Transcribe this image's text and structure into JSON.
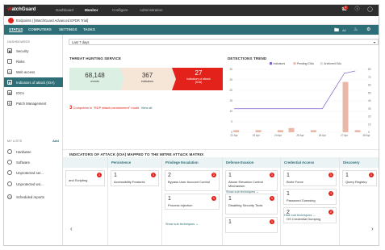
{
  "topbar": {
    "logo_a": "W",
    "logo_b": "atchGuard",
    "nav": [
      "Dashboard",
      "Monitor",
      "Configure",
      "Administration"
    ],
    "active": "Monitor",
    "badge": "4"
  },
  "breadcrumb": {
    "label": "Endpoints",
    "account": "[WatchGuard Advanced EPDR Trial]"
  },
  "subnav": {
    "items": [
      "STATUS",
      "COMPUTERS",
      "SETTINGS",
      "TASKS"
    ],
    "all_label": "All"
  },
  "sidebar": {
    "dashboards_heading": "DASHBOARDS",
    "dashboards": [
      "Security",
      "Risks",
      "Web access",
      "Indicators of attack (IOA)",
      "IOCs",
      "Patch Management"
    ],
    "mylists_heading": "MY LISTS",
    "add_label": "Add",
    "lists": [
      "Hardware",
      "Software",
      "Unprotected ser...",
      "Unprotected wo...",
      "Scheduled reports"
    ]
  },
  "filter": {
    "selected": "Last 7 days"
  },
  "threat_hunting": {
    "title": "THREAT HUNTING SERVICE",
    "events_value": "68,148",
    "events_label": "events",
    "indicators_value": "367",
    "indicators_label": "indicators",
    "ioa_value": "27",
    "ioa_label_1": "indicators of attack",
    "ioa_label_2": "(IOA)",
    "alert_count": "3",
    "alert_text": "Computers in \"RDP attack containment\" mode.",
    "alert_link": "View all"
  },
  "detections_trend": {
    "title": "DETECTIONS TREND",
    "colors": {
      "indicators": "#7b57c9",
      "pending": "#e9b8a8",
      "archived": "#d8d8d8"
    }
  },
  "chart_data": {
    "type": "bar",
    "title": "DETECTIONS TREND",
    "categories": [
      "22 Apr",
      "23 Apr",
      "24 Apr",
      "25 Apr",
      "26 Apr",
      "27 Apr",
      "28 Apr"
    ],
    "series": [
      {
        "name": "Indicators",
        "type": "line",
        "axis": "right",
        "values": [
          30,
          30,
          30,
          30,
          30,
          30,
          30,
          30,
          30,
          75,
          78
        ]
      },
      {
        "name": "Pending IOAs",
        "type": "bar",
        "axis": "left",
        "values": [
          1,
          0,
          1,
          0,
          1,
          2,
          0,
          1,
          0,
          24,
          1
        ]
      },
      {
        "name": "Archived IOAs",
        "type": "bar",
        "axis": "left",
        "values": [
          0,
          0,
          0,
          0,
          0,
          0,
          0,
          0,
          0,
          0,
          0
        ]
      }
    ],
    "line_x": [
      0,
      0.5,
      1,
      1.5,
      2,
      2.5,
      3,
      3.5,
      4,
      5,
      5.5
    ],
    "bar_x": [
      0.1,
      0.6,
      1.1,
      1.6,
      2.1,
      2.6,
      3.1,
      3.6,
      4.1,
      5.05,
      5.6
    ],
    "ylim_left": [
      0,
      30
    ],
    "yticks_left": [
      0,
      5,
      10,
      15,
      20,
      25,
      30
    ],
    "ylim_right": [
      0,
      80
    ],
    "yticks_right": [
      0,
      10,
      20,
      30,
      40,
      50,
      60,
      70,
      80
    ]
  },
  "mitre": {
    "title": "INDICATORS OF ATTACK (IOA) MAPPED TO THE MITRE ATT&CK MATRIX",
    "columns": [
      {
        "name": "",
        "cards": [
          {
            "n": "",
            "t": "and Scripting",
            "b": "1"
          }
        ]
      },
      {
        "name": "Persistence",
        "cards": [
          {
            "n": "1",
            "t": "Accessibility Features",
            "b": "1"
          }
        ]
      },
      {
        "name": "Privilege Escalation",
        "cards": [
          {
            "n": "2",
            "t": "Bypass User Account Control",
            "b": "2"
          },
          {
            "n": "1",
            "t": "Process Injection",
            "b": "1"
          }
        ],
        "link": "Show sub techniques"
      },
      {
        "name": "Defense Evasion",
        "cards": [
          {
            "n": "1",
            "t": "Abuse Elevation Control Mechanism",
            "b": "1"
          },
          {
            "n": "1",
            "t": "Disabling Security Tools",
            "b": "1"
          },
          {
            "n": "1",
            "t": "",
            "b": "1"
          }
        ],
        "link": "Show sub techniques"
      },
      {
        "name": "Credential Access",
        "cards": [
          {
            "n": "1",
            "t": "Brute Force",
            "b": "1"
          },
          {
            "n": "1",
            "t": "Password Guessing",
            "b": "1"
          },
          {
            "n": "2",
            "t": "OS Credential Dumping",
            "b": "2"
          }
        ],
        "link": "Hide sub techniques"
      },
      {
        "name": "Discovery",
        "cards": [
          {
            "n": "1",
            "t": "Query Registry",
            "b": "1"
          }
        ]
      }
    ]
  }
}
